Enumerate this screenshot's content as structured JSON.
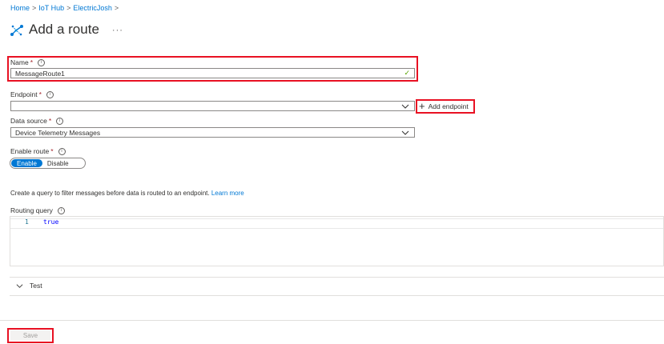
{
  "breadcrumb": {
    "items": [
      "Home",
      "IoT Hub",
      "ElectricJosh"
    ],
    "separator": ">"
  },
  "header": {
    "title": "Add a route",
    "more": "···",
    "icon": "route-icon"
  },
  "form": {
    "name": {
      "label": "Name",
      "required": "*",
      "value": "MessageRoute1"
    },
    "endpoint": {
      "label": "Endpoint",
      "required": "*",
      "value": "",
      "add_label": "Add endpoint"
    },
    "data_source": {
      "label": "Data source",
      "required": "*",
      "value": "Device Telemetry Messages"
    },
    "enable_route": {
      "label": "Enable route",
      "required": "*",
      "on_label": "Enable",
      "off_label": "Disable",
      "selected": "Enable"
    },
    "query_description": "Create a query to filter messages before data is routed to an endpoint.",
    "learn_more": "Learn more",
    "routing_query": {
      "label": "Routing query",
      "line_number": "1",
      "code": "true"
    },
    "test_label": "Test"
  },
  "footer": {
    "save_label": "Save"
  },
  "colors": {
    "accent": "#0078d4",
    "highlight": "#e81123",
    "valid": "#57a300",
    "required": "#a4262c"
  }
}
